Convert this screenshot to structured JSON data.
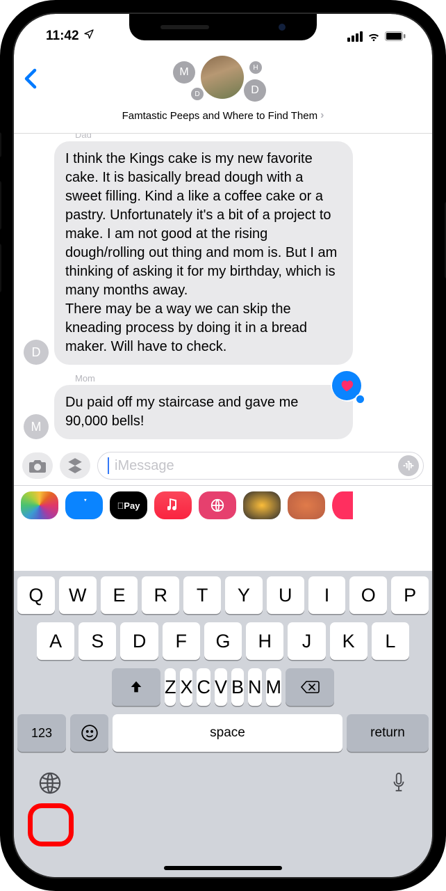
{
  "statusbar": {
    "time": "11:42"
  },
  "header": {
    "group_title": "Famtastic Peeps and Where to Find Them",
    "avatars": {
      "m": "M",
      "h": "H",
      "d_small": "D",
      "d": "D"
    }
  },
  "messages": {
    "dad": {
      "sender": "Dad",
      "avatar": "D",
      "text": "I think the Kings cake is my new favorite cake. It is basically bread dough with a sweet filling. Kind a like a coffee cake or a pastry. Unfortunately it's a bit of a project to make. I am not good at the rising dough/rolling out thing and mom is. But I am thinking of asking it for my birthday, which is many months away.\nThere may be a way we can skip the kneading process by doing it in a bread maker. Will have to check."
    },
    "mom": {
      "sender": "Mom",
      "avatar": "M",
      "text": "Du paid off my staircase and gave me 90,000 bells!"
    }
  },
  "compose": {
    "placeholder": "iMessage"
  },
  "app_strip": {
    "pay_label": "Pay"
  },
  "keyboard": {
    "row1": [
      "Q",
      "W",
      "E",
      "R",
      "T",
      "Y",
      "U",
      "I",
      "O",
      "P"
    ],
    "row2": [
      "A",
      "S",
      "D",
      "F",
      "G",
      "H",
      "J",
      "K",
      "L"
    ],
    "row3": [
      "Z",
      "X",
      "C",
      "V",
      "B",
      "N",
      "M"
    ],
    "num_key": "123",
    "space_key": "space",
    "return_key": "return"
  }
}
